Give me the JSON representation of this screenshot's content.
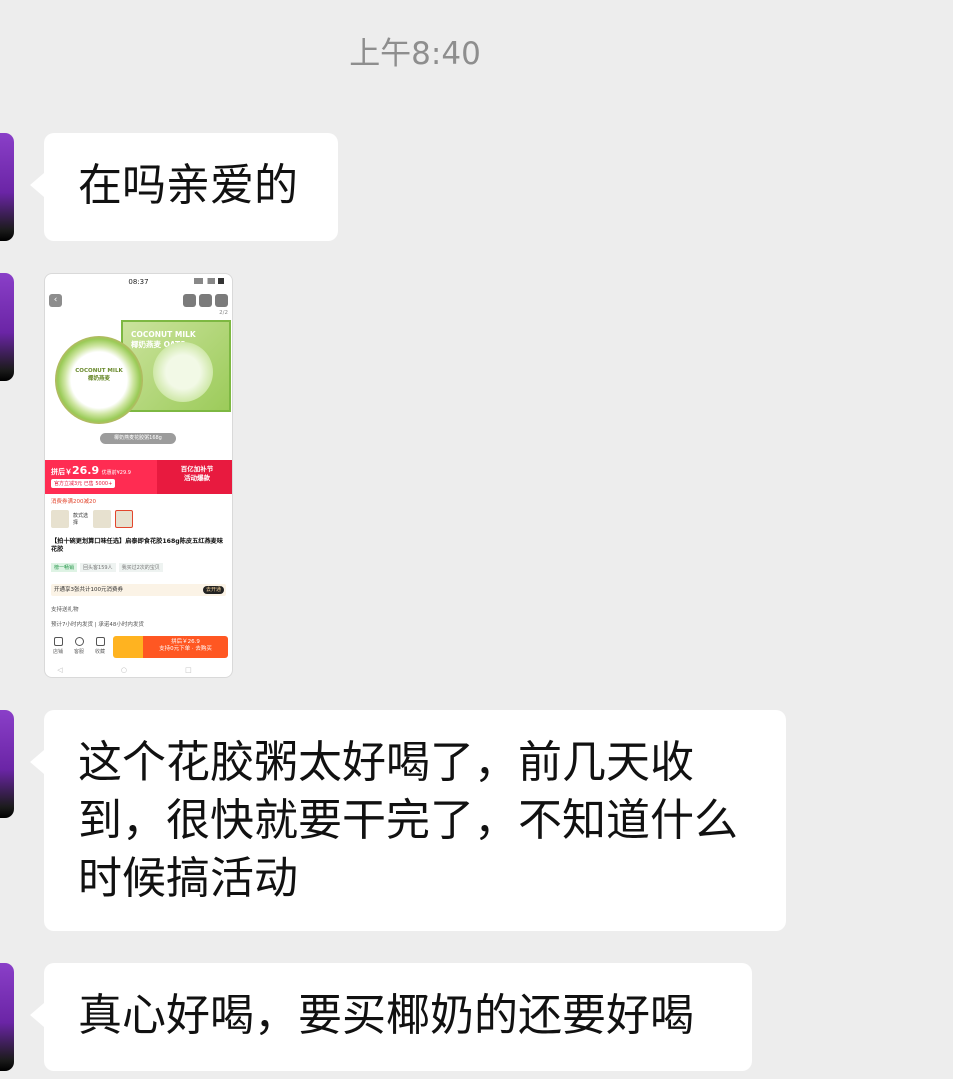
{
  "timestamp": "上午8:40",
  "messages": [
    {
      "type": "text",
      "text": "在吗亲爱的"
    },
    {
      "type": "image",
      "screenshot": {
        "status_time": "08:37",
        "page_indicator": "2/2",
        "box_brand": "COCONUT MILK",
        "box_name": "椰奶燕麦",
        "box_oats": "OATS",
        "tin_brand": "COCONUT MILK",
        "tin_name": "椰奶燕麦",
        "product_pill": "椰奶燕麦花胶粥168g",
        "price_prefix": "拼后￥",
        "price_value": "26.9",
        "price_note": "优惠前¥29.9",
        "official_tag": "官方立减3元",
        "sold": "已售 5000+",
        "subsidy": "百亿加补节",
        "subsidy_sub": "活动爆款",
        "coupon_line": "消费券满200减20",
        "style_choice": "款式选择",
        "title": "【拍十碗更划算口味任选】启泰即食花胶168g陈皮五红燕麦味花胶",
        "tags": [
          "榜一畅销",
          "回头客159人",
          "我买过2次的宝贝"
        ],
        "vip_line": "开通享3张共计100元消费券",
        "vip_button": "去开通",
        "service_1": "支持送礼物",
        "service_2": "预计7小时内发货 | 承诺48小时内发货",
        "bottom_shop": "店铺",
        "bottom_service": "客服",
        "bottom_fav": "收藏",
        "buy_label": "拼后￥26.9",
        "buy_sub": "支持0元下单 · 去购买",
        "gesture_keys": "◁ ○ □"
      }
    },
    {
      "type": "text",
      "text": "这个花胶粥太好喝了，前几天收到，很快就要干完了，不知道什么时候搞活动"
    },
    {
      "type": "text",
      "text": "真心好喝，要买椰奶的还要好喝"
    }
  ]
}
